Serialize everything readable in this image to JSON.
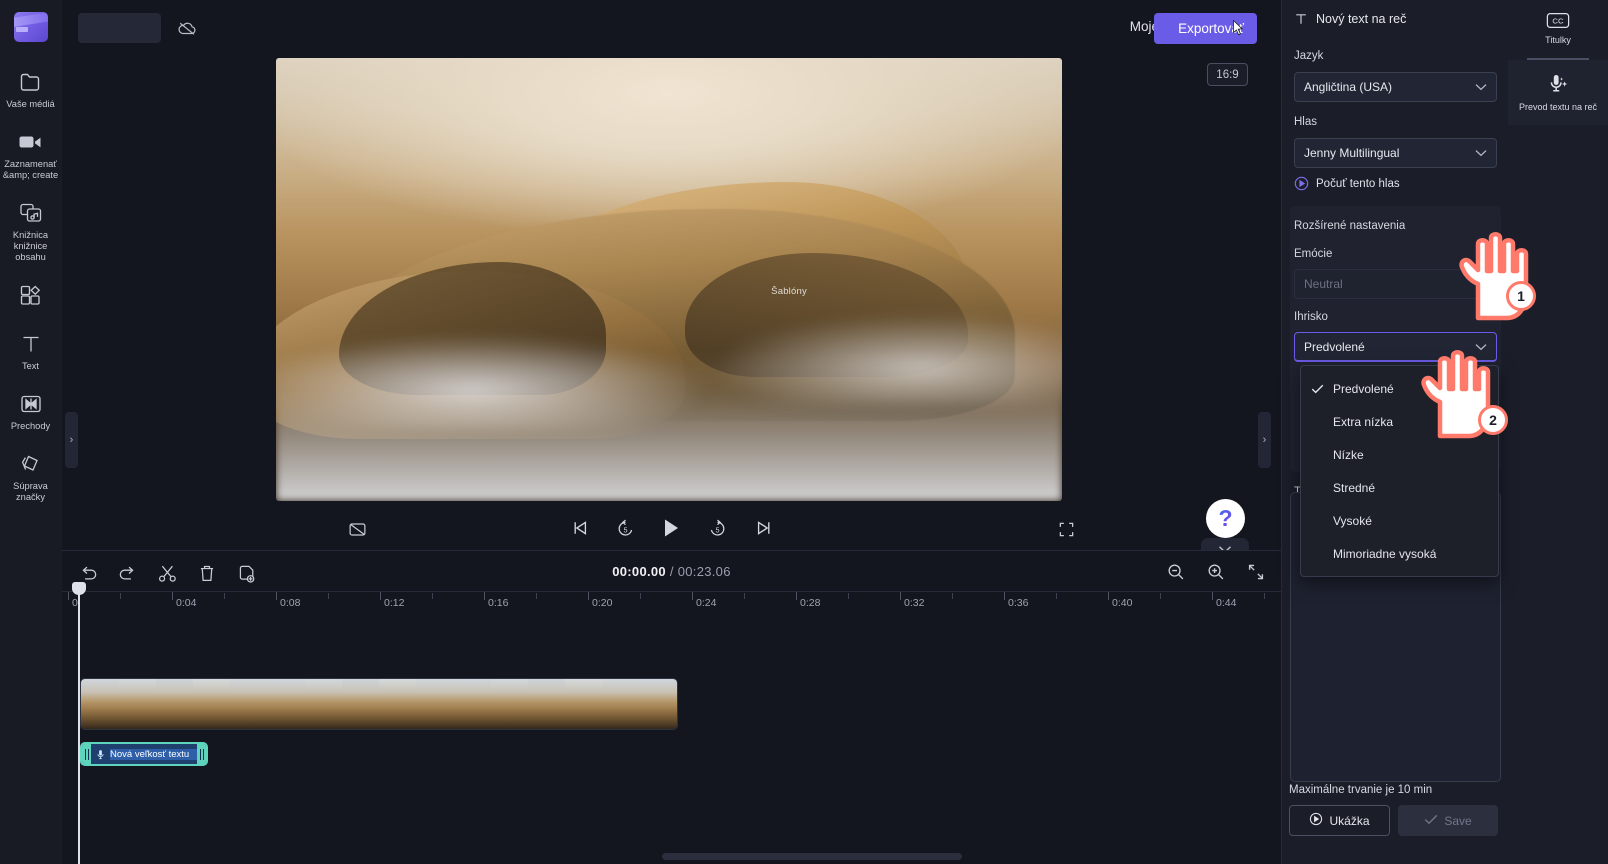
{
  "app": {
    "brand_color": "#6b5ce7",
    "accent_hand": "#ff7a6b"
  },
  "left_rail": {
    "logo_name": "clipchamp-logo",
    "items": [
      {
        "icon": "folder-icon",
        "label": "Vaše médiá"
      },
      {
        "icon": "video-camera-icon",
        "label": "Zaznamenať &amp; create"
      },
      {
        "icon": "content-library-icon",
        "label": "Knižnica knižnice obsahu"
      },
      {
        "icon": "templates-icon",
        "label": ""
      },
      {
        "icon": "text-icon",
        "label": "Text"
      },
      {
        "icon": "transitions-icon",
        "label": "Prechody"
      },
      {
        "icon": "brand-kit-icon",
        "label": "Súprava značky"
      }
    ]
  },
  "topbar": {
    "project_name_value": "",
    "project_name_placeholder": "",
    "cloud_icon": "cloud-off-icon",
    "my_video_label": "Moje video",
    "export_label": "Exportovať"
  },
  "preview": {
    "aspect_ratio": "16:9",
    "watermark": "Šablóny",
    "left_toggle": "›",
    "right_toggle": "›",
    "controls": {
      "captions": "captions-off-icon",
      "skip_start": "skip-to-start-icon",
      "rewind": "rewind-5-icon",
      "play": "play-icon",
      "forward": "forward-5-icon",
      "skip_end": "skip-to-end-icon",
      "fullscreen": "fullscreen-icon"
    },
    "help_label": "?",
    "collapse_label": "⌄"
  },
  "timeline": {
    "tools": [
      {
        "name": "undo-button",
        "glyph": "undo-icon"
      },
      {
        "name": "redo-button",
        "glyph": "redo-icon"
      },
      {
        "name": "split-button",
        "glyph": "scissors-icon"
      },
      {
        "name": "delete-button",
        "glyph": "trash-icon"
      },
      {
        "name": "duplicate-button",
        "glyph": "duplicate-icon"
      }
    ],
    "current_time": "00:00.00",
    "separator": "/",
    "total_time": "00:23.06",
    "zoom_out": "zoom-out-icon",
    "zoom_in": "zoom-in-icon",
    "fit": "fit-to-screen-icon",
    "ruler_labels": [
      "0",
      "0:04",
      "0:08",
      "0:12",
      "0:16",
      "0:20",
      "0:24",
      "0:28",
      "0:32",
      "0:36",
      "0:40",
      "0:44"
    ],
    "audio_clip_label": "Nová veľkosť textu"
  },
  "right_panel": {
    "header_icon": "text-to-speech-icon",
    "header_title": "Nový text na reč",
    "language_label": "Jazyk",
    "language_value": "Angličtina (USA)",
    "voice_label": "Hlas",
    "voice_value": "Jenny Multilingual",
    "listen_label": "Počuť tento hlas",
    "advanced_label": "Rozšírené nastavenia",
    "emotion_label": "Emócie",
    "emotion_value": "Neutral",
    "pitch_label": "Ihrisko",
    "pitch_value": "Predvolené",
    "pitch_options": [
      {
        "label": "Predvolené",
        "selected": true
      },
      {
        "label": "Extra nízka",
        "selected": false
      },
      {
        "label": "Nízke",
        "selected": false
      },
      {
        "label": "Stredné",
        "selected": false
      },
      {
        "label": "Vysoké",
        "selected": false
      },
      {
        "label": "Mimoriadne vysoká",
        "selected": false
      }
    ],
    "text_label": "Te",
    "text_value": "",
    "max_duration": "Maximálne trvanie je 10 min",
    "preview_button": "Ukážka",
    "save_button": "Save"
  },
  "far_rail": {
    "items": [
      {
        "icon": "closed-captions-icon",
        "label": "Titulky",
        "active": false
      },
      {
        "icon": "text-to-speech-mic-icon",
        "label": "Prevod textu na reč",
        "active": true
      }
    ]
  },
  "callouts": [
    {
      "number": "1"
    },
    {
      "number": "2"
    }
  ]
}
